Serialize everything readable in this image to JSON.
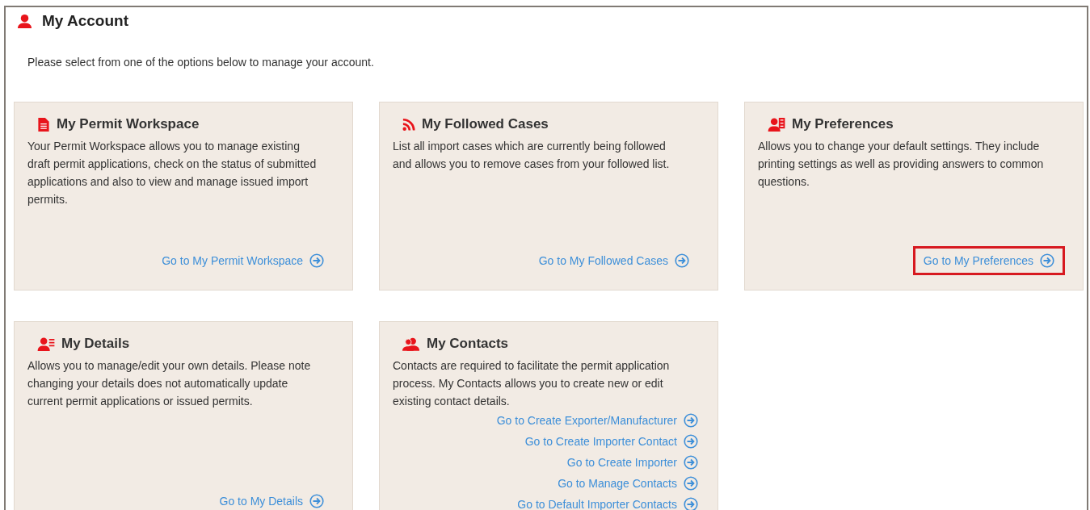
{
  "page": {
    "title": "My Account",
    "intro": "Please select from one of the options below to manage your account."
  },
  "cards": [
    {
      "title": "My Permit Workspace",
      "text": "Your Permit Workspace allows you to manage existing draft permit applications, check on the status of submitted applications and also to view and manage issued import permits.",
      "links": [
        {
          "label": "Go to My Permit Workspace",
          "highlighted": false
        }
      ]
    },
    {
      "title": "My Followed Cases",
      "text": "List all import cases which are currently being followed and allows you to remove cases from your followed list.",
      "links": [
        {
          "label": "Go to My Followed Cases",
          "highlighted": false
        }
      ]
    },
    {
      "title": "My Preferences",
      "text": "Allows you to change your default settings. They include printing settings as well as providing answers to common questions.",
      "links": [
        {
          "label": "Go to My Preferences",
          "highlighted": true
        }
      ]
    },
    {
      "title": "My Details",
      "text": "Allows you to manage/edit your own details. Please note changing your details does not automatically update current permit applications or issued permits.",
      "links": [
        {
          "label": "Go to My Details",
          "highlighted": false
        }
      ]
    },
    {
      "title": "My Contacts",
      "text": "Contacts are required to facilitate the permit application process. My Contacts allows you to create new or edit existing contact details.",
      "links": [
        {
          "label": "Go to Create Exporter/Manufacturer",
          "highlighted": false
        },
        {
          "label": "Go to Create Importer Contact",
          "highlighted": false
        },
        {
          "label": "Go to Create Importer",
          "highlighted": false
        },
        {
          "label": "Go to Manage Contacts",
          "highlighted": false
        },
        {
          "label": "Go to Default Importer Contacts",
          "highlighted": false
        }
      ]
    }
  ]
}
